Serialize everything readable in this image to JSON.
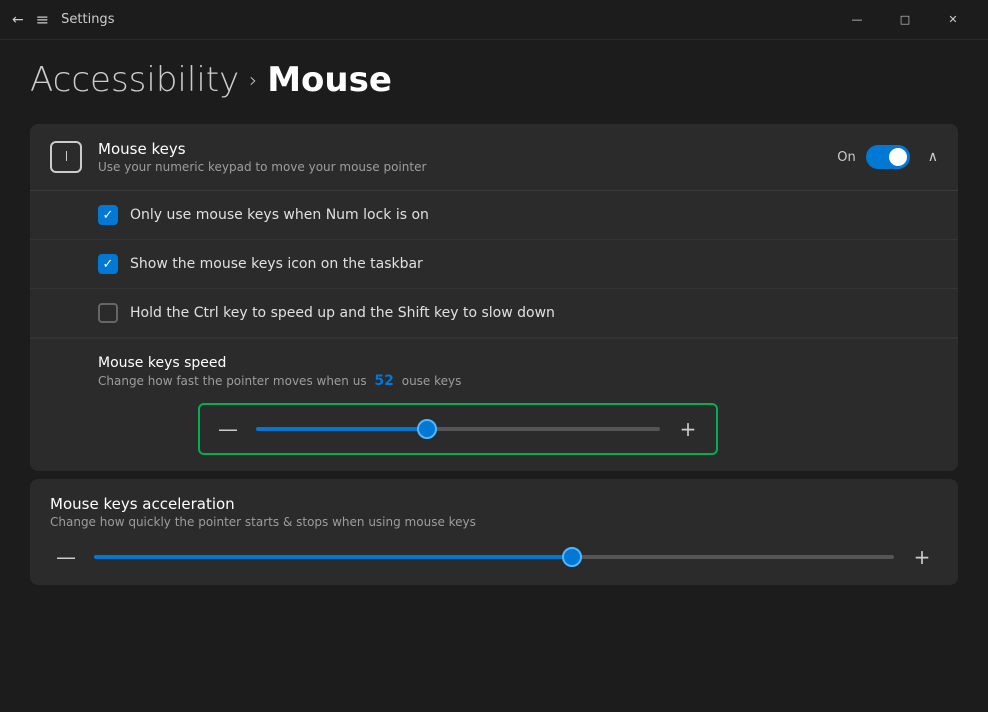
{
  "titlebar": {
    "title": "Settings",
    "back_label": "←",
    "menu_label": "≡",
    "min_label": "—",
    "max_label": "□",
    "close_label": "✕"
  },
  "breadcrumb": {
    "accessibility": "Accessibility",
    "chevron": "›",
    "page": "Mouse"
  },
  "mousekeys": {
    "title": "Mouse keys",
    "description": "Use your numeric keypad to move your mouse pointer",
    "toggle_label": "On",
    "toggle_on": true
  },
  "options": [
    {
      "id": "numlock",
      "label": "Only use mouse keys when Num lock is on",
      "checked": true
    },
    {
      "id": "taskbar",
      "label": "Show the mouse keys icon on the taskbar",
      "checked": true
    },
    {
      "id": "ctrl_shift",
      "label": "Hold the Ctrl key to speed up and the Shift key to slow down",
      "checked": false
    }
  ],
  "speed": {
    "title": "Mouse keys speed",
    "description_before": "Change how fast the pointer moves when us",
    "value": "52",
    "description_after": "ouse keys",
    "minus": "—",
    "plus": "+"
  },
  "acceleration": {
    "title": "Mouse keys acceleration",
    "description": "Change how quickly the pointer starts & stops when using mouse keys",
    "minus": "—",
    "plus": "+"
  }
}
